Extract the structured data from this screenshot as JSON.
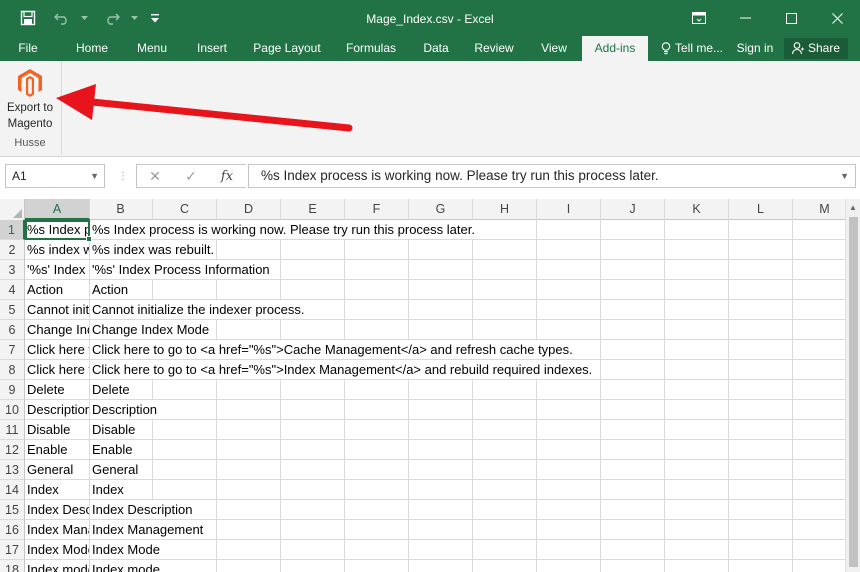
{
  "window": {
    "title": "Mage_Index.csv - Excel"
  },
  "quick_access": {
    "icons": [
      "save-icon",
      "undo-icon",
      "redo-icon",
      "customize-qat-icon"
    ]
  },
  "window_controls": {
    "icons": [
      "ribbon-display-icon",
      "minimize-icon",
      "maximize-icon",
      "close-icon"
    ]
  },
  "ribbon_tabs": {
    "file": "File",
    "home": "Home",
    "menu": "Menu",
    "insert": "Insert",
    "page_layout": "Page Layout",
    "formulas": "Formulas",
    "data": "Data",
    "review": "Review",
    "view": "View",
    "addins": "Add-ins",
    "tell_me": "Tell me...",
    "sign_in": "Sign in",
    "share": "Share",
    "active": "Add-ins"
  },
  "ribbon": {
    "export_button_line1": "Export to",
    "export_button_line2": "Magento",
    "group_label": "Husse",
    "annotation": "red-arrow"
  },
  "formula_bar": {
    "name_box": "A1",
    "cancel_symbol": "✕",
    "enter_symbol": "✓",
    "fx_symbol": "fx",
    "content": "%s Index process is working now. Please try run this process later."
  },
  "columns": [
    "A",
    "B",
    "C",
    "D",
    "E",
    "F",
    "G",
    "H",
    "I",
    "J",
    "K",
    "L",
    "M"
  ],
  "selected_cell": "A1",
  "rows": [
    {
      "num": "1",
      "a": "%s Index process is working now. Please try run this process later.",
      "b": "%s Index process is working now. Please try run this process later."
    },
    {
      "num": "2",
      "a": "%s index was rebuilt.",
      "b": "%s index was rebuilt."
    },
    {
      "num": "3",
      "a": "'%s' Index Process Information",
      "b": "'%s' Index Process Information"
    },
    {
      "num": "4",
      "a": "Action",
      "b": "Action"
    },
    {
      "num": "5",
      "a": "Cannot initialize the indexer process.",
      "b": "Cannot initialize the indexer process."
    },
    {
      "num": "6",
      "a": "Change Index Mode",
      "b": "Change Index Mode"
    },
    {
      "num": "7",
      "a": "Click here to go to <a href=\"%s\">Cache Management</a> and refresh cache types.",
      "b": "Click here to go to <a href=\"%s\">Cache Management</a> and refresh cache types."
    },
    {
      "num": "8",
      "a": "Click here to go to <a href=\"%s\">Index Management</a> and rebuild required indexes.",
      "b": "Click here to go to <a href=\"%s\">Index Management</a> and rebuild required indexes."
    },
    {
      "num": "9",
      "a": "Delete",
      "b": "Delete"
    },
    {
      "num": "10",
      "a": "Description",
      "b": "Description"
    },
    {
      "num": "11",
      "a": "Disable",
      "b": "Disable"
    },
    {
      "num": "12",
      "a": "Enable",
      "b": "Enable"
    },
    {
      "num": "13",
      "a": "General",
      "b": "General"
    },
    {
      "num": "14",
      "a": "Index",
      "b": "Index"
    },
    {
      "num": "15",
      "a": "Index Description",
      "b": "Index Description"
    },
    {
      "num": "16",
      "a": "Index Management",
      "b": "Index Management"
    },
    {
      "num": "17",
      "a": "Index Mode",
      "b": "Index Mode"
    },
    {
      "num": "18",
      "a": "Index mode",
      "b": "Index mode"
    }
  ],
  "colors": {
    "accent": "#217346",
    "annotation_arrow": "#e8141b",
    "magento_orange": "#f26322"
  }
}
